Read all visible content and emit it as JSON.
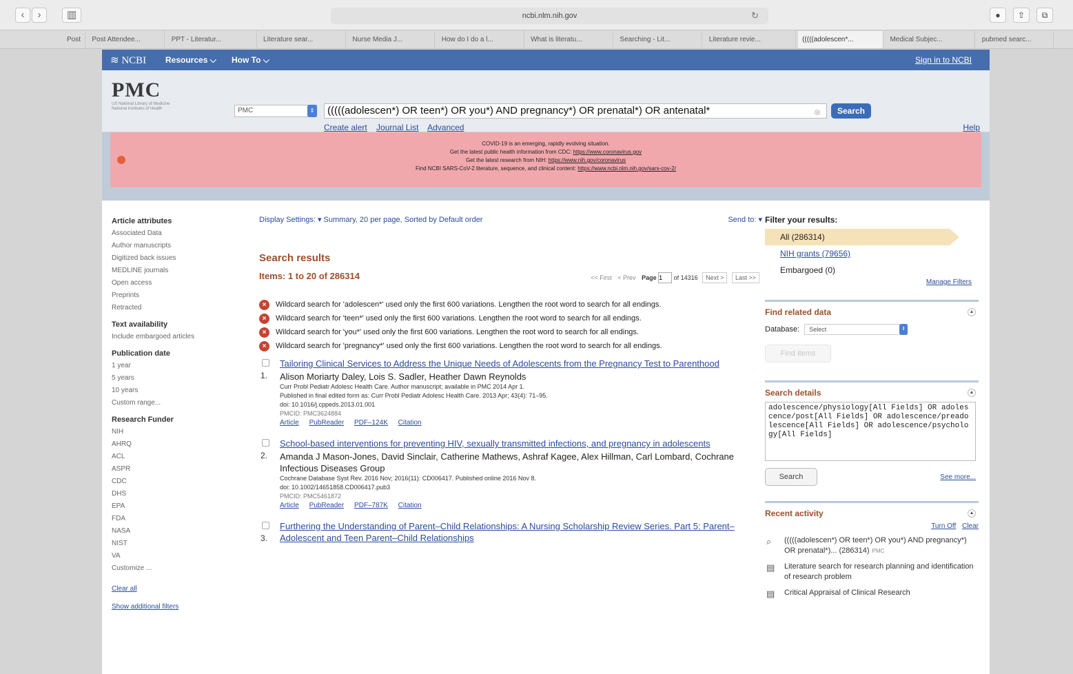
{
  "browser": {
    "back_glyph": "‹",
    "forward_glyph": "›",
    "sidebar_glyph": "▥",
    "url": "ncbi.nlm.nih.gov",
    "reload_glyph": "↻",
    "right_buttons": [
      "●",
      "⇧",
      "⧉"
    ],
    "tabs": [
      "Post",
      "Post Attendee...",
      "PPT - Literatur...",
      "Literature sear...",
      "Nurse Media J...",
      "How do I do a l...",
      "What is literatu...",
      "Searching - Lit...",
      "Literature revie...",
      "(((((adolescen*...",
      "Medical Subjec...",
      "pubmed searc..."
    ]
  },
  "ncbi": {
    "logo": "NCBI",
    "resources": "Resources",
    "how_to": "How To",
    "sign_in": "Sign in to NCBI"
  },
  "search": {
    "logo": "PMC",
    "logo_sub1": "US National Library of Medicine",
    "logo_sub2": "National Institutes of Health",
    "database": "PMC",
    "query": "(((((adolescen*) OR teen*) OR you*) AND pregnancy*) OR prenatal*) OR antenatal*",
    "button": "Search",
    "links": [
      "Create alert",
      "Journal List",
      "Advanced"
    ],
    "help": "Help"
  },
  "alert": {
    "line1": "COVID-19 is an emerging, rapidly evolving situation.",
    "line2_text": "Get the latest public health information from CDC: ",
    "line2_link": "https://www.coronavirus.gov",
    "line3_text": "Get the latest research from NIH: ",
    "line3_link": "https://www.nih.gov/coronavirus",
    "line4_text": "Find NCBI SARS-CoV-2 literature, sequence, and clinical content: ",
    "line4_link": "https://www.ncbi.nlm.nih.gov/sars-cov-2/"
  },
  "left": {
    "article_h": "Article attributes",
    "article": [
      "Associated Data",
      "Author manuscripts",
      "Digitized back issues",
      "MEDLINE journals",
      "Open access",
      "Preprints",
      "Retracted"
    ],
    "text_h": "Text availability",
    "text": [
      "Include embargoed articles"
    ],
    "pub_h": "Publication date",
    "pub": [
      "1 year",
      "5 years",
      "10 years",
      "Custom range..."
    ],
    "funder_h": "Research Funder",
    "funder": [
      "NIH",
      "AHRQ",
      "ACL",
      "ASPR",
      "CDC",
      "DHS",
      "EPA",
      "FDA",
      "NASA",
      "NIST",
      "VA",
      "Customize ..."
    ],
    "clear_all": "Clear all",
    "show_filters": "Show additional filters"
  },
  "main": {
    "display_settings": "Display Settings: ▾  Summary, 20 per page, Sorted by Default order",
    "send_to": "Send to: ▾",
    "title": "Search results",
    "items": "Items: 1 to 20 of 286314",
    "pager": {
      "first": "<< First",
      "prev": "< Prev",
      "page_label": "Page",
      "page_value": "1",
      "of": "of 14316",
      "next": "Next >",
      "last": "Last >>"
    },
    "warnings": [
      "Wildcard search for 'adolescen*' used only the first 600 variations. Lengthen the root word to search for all endings.",
      "Wildcard search for 'teen*' used only the first 600 variations. Lengthen the root word to search for all endings.",
      "Wildcard search for 'you*' used only the first 600 variations. Lengthen the root word to search for all endings.",
      "Wildcard search for 'pregnancy*' used only the first 600 variations. Lengthen the root word to search for all endings."
    ],
    "results": [
      {
        "num": "1.",
        "title": "Tailoring Clinical Services to Address the Unique Needs of Adolescents from the Pregnancy Test to Parenthood",
        "authors": "Alison Moriarty Daley, Lois S. Sadler, Heather Dawn Reynolds",
        "meta1": "Curr Probl Pediatr Adolesc Health Care. Author manuscript; available in PMC 2014 Apr 1.",
        "meta2": "Published in final edited form as: Curr Probl Pediatr Adolesc Health Care. 2013 Apr; 43(4): 71–95.",
        "meta3": "doi: 10.1016/j.cppeds.2013.01.001",
        "pmcid": "PMCID: PMC3624884",
        "links": [
          "Article",
          "PubReader",
          "PDF–124K",
          "Citation"
        ]
      },
      {
        "num": "2.",
        "title": "School-based interventions for preventing HIV, sexually transmitted infections, and pregnancy in adolescents",
        "authors": "Amanda J Mason-Jones, David Sinclair, Catherine Mathews, Ashraf Kagee, Alex Hillman, Carl Lombard, Cochrane Infectious Diseases Group",
        "meta1": "Cochrane Database Syst Rev. 2016 Nov; 2016(11): CD006417. Published online 2016 Nov 8.",
        "meta2": "doi: 10.1002/14651858.CD006417.pub3",
        "meta3": "",
        "pmcid": "PMCID: PMC5461872",
        "links": [
          "Article",
          "PubReader",
          "PDF–787K",
          "Citation"
        ]
      },
      {
        "num": "3.",
        "title": "Furthering the Understanding of Parent–Child Relationships: A Nursing Scholarship Review Series. Part 5: Parent–Adolescent and Teen Parent–Child Relationships",
        "authors": "",
        "meta1": "",
        "meta2": "",
        "meta3": "",
        "pmcid": "",
        "links": []
      }
    ]
  },
  "right": {
    "filter_h": "Filter your results:",
    "filters": [
      "All (286314)",
      "NIH grants (79656)",
      "Embargoed (0)"
    ],
    "manage": "Manage Filters",
    "related_h": "Find related data",
    "database_label": "Database:",
    "database_select": "Select",
    "find_items": "Find items",
    "details_h": "Search details",
    "details_text": "adolescence/physiology[All Fields] OR adolescence/post[All Fields] OR adolescence/preadolescence[All Fields] OR adolescence/psychology[All Fields]",
    "details_search": "Search",
    "see_more": "See more...",
    "recent_h": "Recent activity",
    "turn_off": "Turn Off",
    "clear": "Clear",
    "recent": [
      {
        "icon": "⌕",
        "text": "(((((adolescen*) OR teen*) OR you*) AND pregnancy*) OR prenatal*)... (286314)",
        "db": "PMC"
      },
      {
        "icon": "▤",
        "text": "Literature search for research planning and identification of research problem",
        "db": ""
      },
      {
        "icon": "▤",
        "text": "Critical Appraisal of Clinical Research",
        "db": ""
      }
    ]
  }
}
